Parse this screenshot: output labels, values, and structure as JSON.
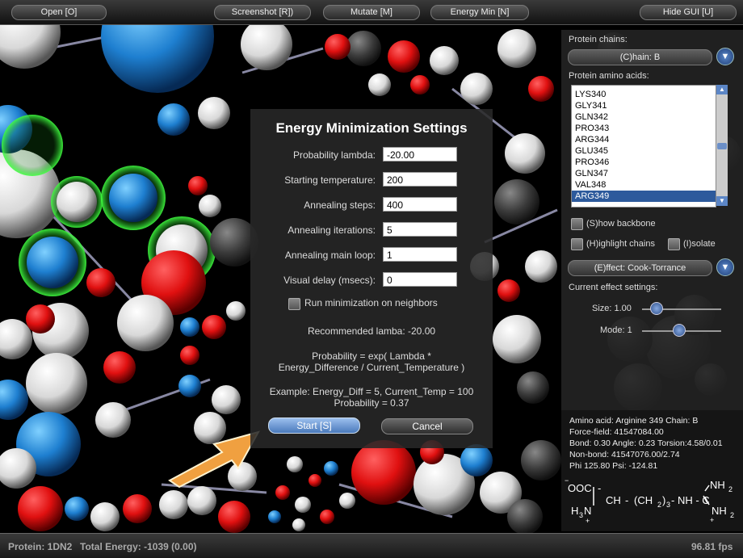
{
  "toolbar": {
    "open_label": "Open [O]",
    "screenshot_label": "Screenshot [R])",
    "mutate_label": "Mutate [M]",
    "energy_min_label": "Energy Min [N]",
    "hide_gui_label": "Hide GUI [U]"
  },
  "dialog": {
    "title": "Energy Minimization Settings",
    "fields": [
      {
        "label": "Probability lambda:",
        "value": "-20.00"
      },
      {
        "label": "Starting temperature:",
        "value": "200"
      },
      {
        "label": "Annealing steps:",
        "value": "400"
      },
      {
        "label": "Annealing iterations:",
        "value": "5"
      },
      {
        "label": "Annealing main loop:",
        "value": "1"
      },
      {
        "label": "Visual delay (msecs):",
        "value": "0"
      }
    ],
    "neighbors_label": "Run minimization on neighbors",
    "recommended": "Recommended lamba: -20.00",
    "formula_line1": "Probability = exp( Lambda *",
    "formula_line2": "Energy_Difference / Current_Temperature )",
    "example_line1": "Example: Energy_Diff = 5, Current_Temp = 100",
    "example_line2": "Probability = 0.37",
    "start_label": "Start [S]",
    "cancel_label": "Cancel"
  },
  "panel": {
    "chains_label": "Protein chains:",
    "chain_value": "(C)hain: B",
    "amino_label": "Protein amino acids:",
    "amino_acids": [
      "LYS340",
      "GLY341",
      "GLN342",
      "PRO343",
      "ARG344",
      "GLU345",
      "PRO346",
      "GLN347",
      "VAL348",
      "ARG349"
    ],
    "selected_amino": "ARG349",
    "show_backbone": "(S)how backbone",
    "highlight_chains": "(H)ighlight chains",
    "isolate": "(I)solate",
    "effect_value": "(E)ffect: Cook-Torrance",
    "effect_settings_label": "Current effect settings:",
    "size_label": "Size: 1.00",
    "mode_label": "Mode: 1"
  },
  "info": {
    "line1": "Amino acid: Arginine 349  Chain: B",
    "line2": "Force-field: 41547084.00",
    "line3": "Bond: 0.30 Angle: 0.23 Torsion:4.58/0.01",
    "line4": "Non-bond: 41547076.00/2.74",
    "line5": "Phi 125.80 Psi: -124.81"
  },
  "formula": {
    "ooc": "OOC",
    "ch": "CH",
    "chain_group": "(CH",
    "sub2": "2",
    "close": ")",
    "sub3": "3",
    "nh_c": "- NH - C",
    "nh2_top": "NH",
    "nh2_top_sub": "2",
    "h3n": "H",
    "h3n_sub": "3",
    "h3n_n": "N",
    "nh2_bottom": "NH",
    "nh2_bottom_sub": "2",
    "plus": "+"
  },
  "status": {
    "protein": "Protein: 1DN2",
    "energy": "Total Energy: -1039 (0.00)",
    "fps": "96.81 fps"
  },
  "colors": {
    "accent": "#2d5a9c",
    "atom_red": "#e01010",
    "atom_white": "#f0f0f0",
    "atom_blue": "#1e7fd0",
    "arrow": "#f0a040"
  }
}
